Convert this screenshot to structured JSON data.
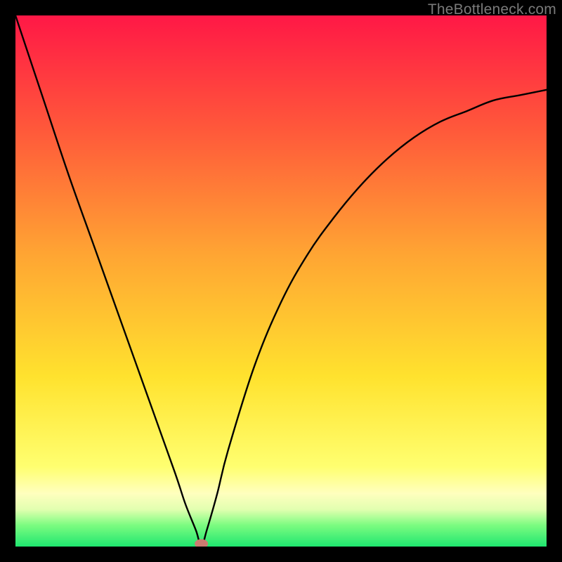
{
  "watermark": "TheBottleneck.com",
  "chart_data": {
    "type": "line",
    "title": "",
    "xlabel": "",
    "ylabel": "",
    "xlim": [
      0,
      100
    ],
    "ylim": [
      0,
      100
    ],
    "grid": false,
    "series": [
      {
        "name": "bottleneck-curve",
        "x": [
          0,
          5,
          10,
          15,
          20,
          25,
          30,
          32,
          34,
          35,
          36,
          38,
          40,
          45,
          50,
          55,
          60,
          65,
          70,
          75,
          80,
          85,
          90,
          95,
          100
        ],
        "y": [
          100,
          85,
          70,
          56,
          42,
          28,
          14,
          8,
          3,
          0,
          3,
          10,
          18,
          34,
          46,
          55,
          62,
          68,
          73,
          77,
          80,
          82,
          84,
          85,
          86
        ]
      }
    ],
    "marker": {
      "x": 35,
      "y": 0,
      "color": "#cc7b71"
    },
    "background_gradient": {
      "stops": [
        {
          "pos": 0,
          "color": "#ff1846"
        },
        {
          "pos": 22,
          "color": "#ff5a3a"
        },
        {
          "pos": 45,
          "color": "#ffa533"
        },
        {
          "pos": 68,
          "color": "#ffe22e"
        },
        {
          "pos": 85,
          "color": "#ffff70"
        },
        {
          "pos": 90,
          "color": "#ffffbe"
        },
        {
          "pos": 93,
          "color": "#e2ffb0"
        },
        {
          "pos": 96,
          "color": "#7bfc80"
        },
        {
          "pos": 100,
          "color": "#1fe670"
        }
      ]
    }
  }
}
